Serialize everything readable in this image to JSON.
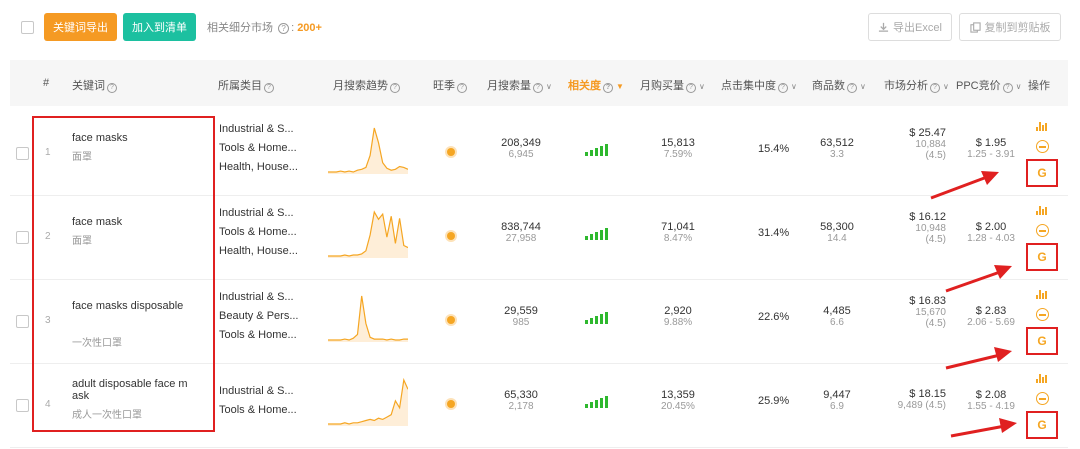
{
  "toolbar": {
    "export_keywords": "关键词导出",
    "add_to_list": "加入到清单",
    "market_label": "相关细分市场",
    "market_count": "200+",
    "export_excel": "导出Excel",
    "copy_clipboard": "复制到剪贴板"
  },
  "header": {
    "index": "#",
    "keyword": "关键词",
    "category": "所属类目",
    "trend": "月搜索趋势",
    "season": "旺季",
    "monthly_search": "月搜索量",
    "relevance": "相关度",
    "monthly_sales": "月购买量",
    "click_concentration": "点击集中度",
    "product_count": "商品数",
    "market_analysis": "市场分析",
    "ppc_bid": "PPC竞价",
    "action": "操作"
  },
  "rows": [
    {
      "index": "1",
      "keyword": "face masks",
      "keyword_cn": "面罩",
      "categories": [
        "Industrial & S...",
        "Tools & Home...",
        "Health, House..."
      ],
      "search_volume": "208,349",
      "search_sub": "6,945",
      "sales": "15,813",
      "sales_pct": "7.59%",
      "click": "15.4%",
      "products": "63,512",
      "products_sub": "3.3",
      "price": "$ 25.47",
      "reviews": "10,884",
      "rating": "(4.5)",
      "ppc": "$ 1.95",
      "ppc_range": "1.25 - 3.91",
      "trend": [
        0,
        0,
        0,
        1,
        0,
        1,
        0,
        2,
        3,
        5,
        18,
        48,
        32,
        10,
        4,
        2,
        3,
        6,
        5,
        3
      ]
    },
    {
      "index": "2",
      "keyword": "face mask",
      "keyword_cn": "面罩",
      "categories": [
        "Industrial & S...",
        "Tools & Home...",
        "Health, House..."
      ],
      "search_volume": "838,744",
      "search_sub": "27,958",
      "sales": "71,041",
      "sales_pct": "8.47%",
      "click": "31.4%",
      "products": "58,300",
      "products_sub": "14.4",
      "price": "$ 16.12",
      "reviews": "10,948",
      "rating": "(4.5)",
      "ppc": "$ 2.00",
      "ppc_range": "1.28 - 4.03",
      "trend": [
        0,
        0,
        0,
        0,
        1,
        0,
        1,
        1,
        2,
        5,
        20,
        42,
        35,
        40,
        18,
        38,
        12,
        36,
        10,
        8
      ]
    },
    {
      "index": "3",
      "keyword": "face masks disposable",
      "keyword_cn": "一次性口罩",
      "categories": [
        "Industrial & S...",
        "Beauty & Pers...",
        "Tools & Home..."
      ],
      "search_volume": "29,559",
      "search_sub": "985",
      "sales": "2,920",
      "sales_pct": "9.88%",
      "click": "22.6%",
      "products": "4,485",
      "products_sub": "6.6",
      "price": "$ 16.83",
      "reviews": "15,670",
      "rating": "(4.5)",
      "ppc": "$ 2.83",
      "ppc_range": "2.06 - 5.69",
      "trend": [
        0,
        0,
        0,
        0,
        1,
        0,
        2,
        6,
        48,
        18,
        3,
        1,
        1,
        1,
        0,
        1,
        0,
        0,
        1,
        1
      ]
    },
    {
      "index": "4",
      "keyword": "adult disposable face m ask",
      "keyword_cn": "成人一次性口罩",
      "categories": [
        "Industrial & S...",
        "Tools & Home..."
      ],
      "search_volume": "65,330",
      "search_sub": "2,178",
      "sales": "13,359",
      "sales_pct": "20.45%",
      "click": "25.9%",
      "products": "9,447",
      "products_sub": "6.9",
      "price": "$ 18.15",
      "reviews": "9,489 (4.5)",
      "rating": "",
      "ppc": "$ 2.08",
      "ppc_range": "1.55 - 4.19",
      "trend": [
        0,
        0,
        0,
        0,
        1,
        0,
        1,
        1,
        2,
        3,
        4,
        3,
        5,
        4,
        6,
        8,
        20,
        14,
        38,
        30
      ]
    }
  ],
  "colors": {
    "accent_orange": "#f59a23",
    "accent_green": "#1cc0a0",
    "signal_green": "#2eb82e",
    "highlight_red": "#e02020"
  },
  "icons": {
    "google": "G",
    "trend_chart": "bar-chart-icon",
    "remove": "minus-circle-icon",
    "download": "download-icon",
    "copy": "copy-icon"
  }
}
